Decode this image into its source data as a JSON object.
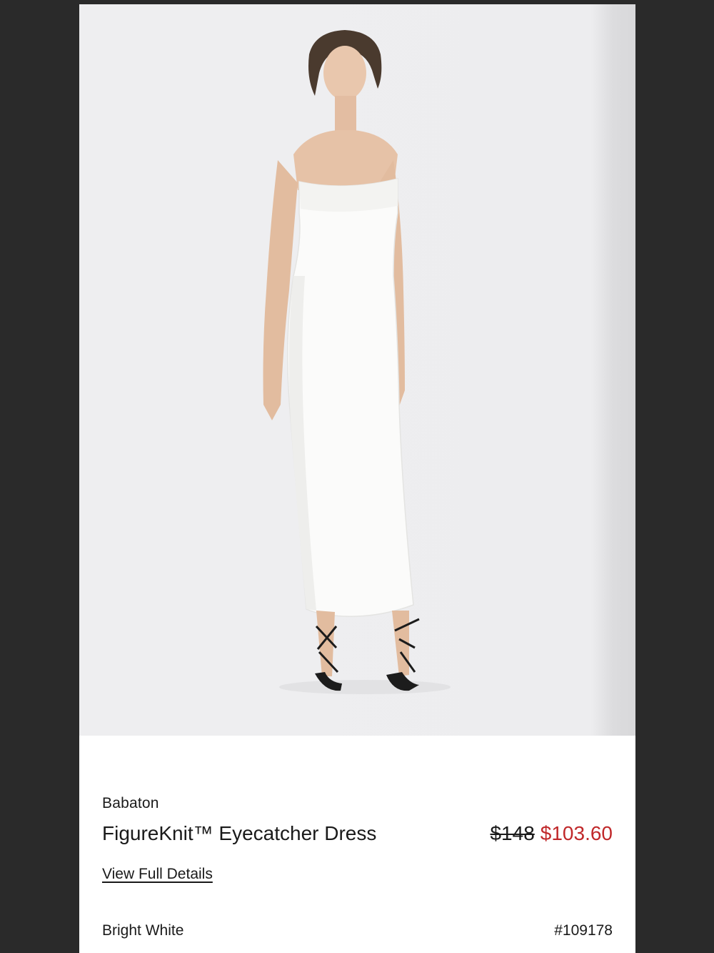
{
  "product": {
    "brand": "Babaton",
    "name": "FigureKnit™ Eyecatcher Dress",
    "original_price": "$148",
    "sale_price": "$103.60",
    "view_details_label": "View Full Details",
    "color_name": "Bright White",
    "style_number": "#109178"
  },
  "colors": {
    "sale": "#c0282a",
    "text": "#1a1a1a",
    "photo_background": "#ededef"
  }
}
